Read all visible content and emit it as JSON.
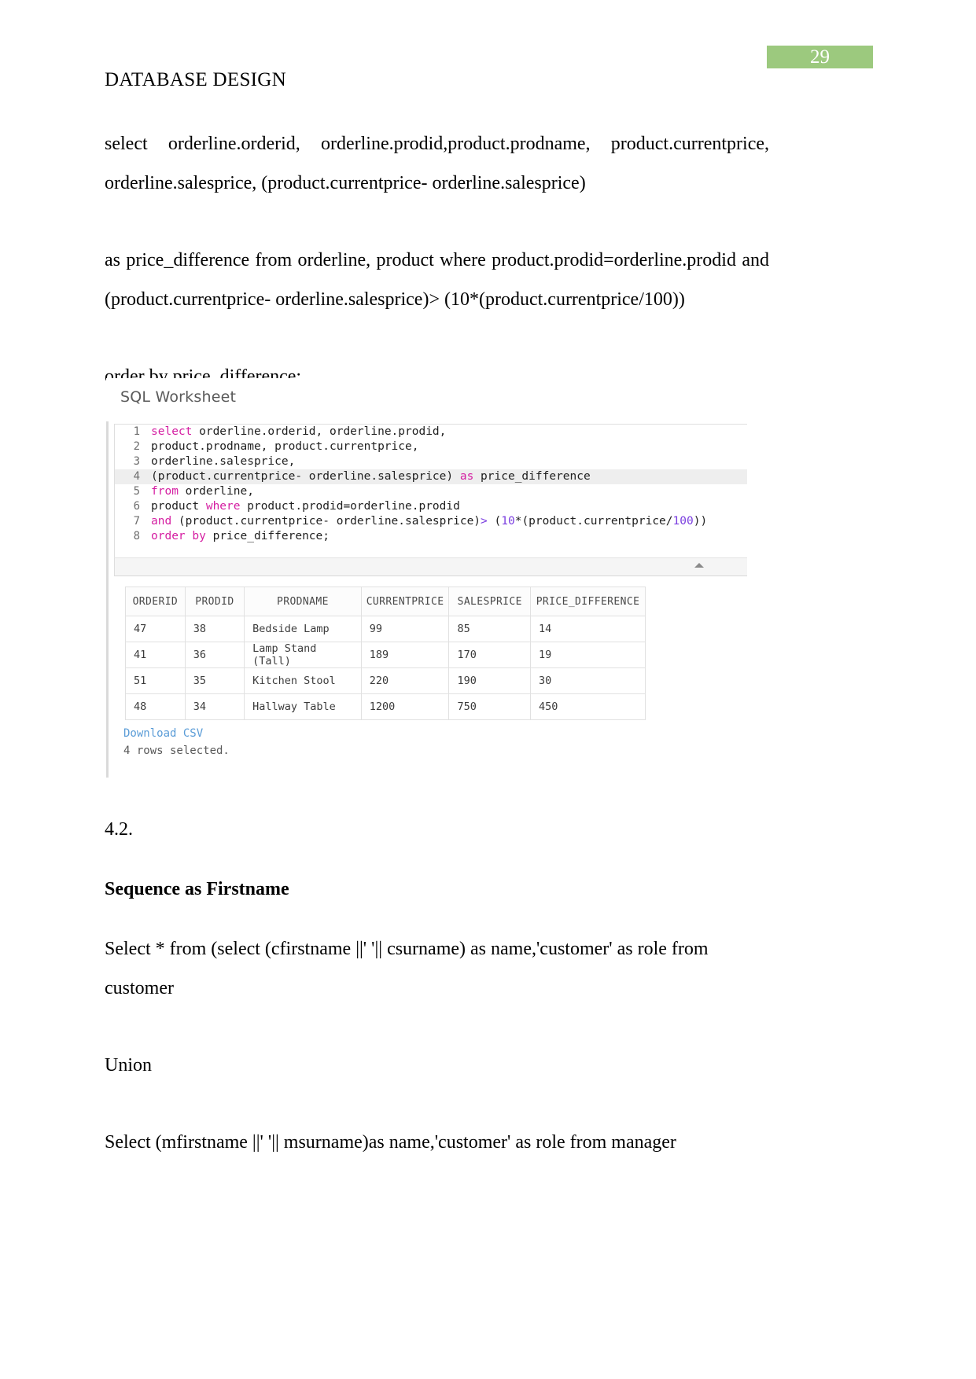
{
  "page": {
    "number": "29",
    "badge_color": "#9cc97e"
  },
  "document": {
    "title": "DATABASE DESIGN",
    "paragraphs": [
      "select     orderline.orderid,      orderline.prodid,product.prodname,      product.currentprice, orderline.salesprice,  (product.currentprice- orderline.salesprice)",
      "as  price_difference  from  orderline,  product  where  product.prodid=orderline.prodid  and (product.currentprice- orderline.salesprice)> (10*(product.currentprice/100))",
      "order by price_difference;"
    ],
    "section_number": "4.2.",
    "section_heading": "Sequence as Firstname",
    "closing_paragraphs": [
      "Select * from (select  (cfirstname ||' '|| csurname) as name,'customer' as role from customer",
      "Union",
      "Select  (mfirstname ||' '|| msurname)as name,'customer' as role  from manager"
    ]
  },
  "screenshot": {
    "title": "SQL Worksheet",
    "highlighted_line": 4,
    "code_lines": [
      {
        "n": "1",
        "segments": [
          {
            "t": "select",
            "c": "kw"
          },
          {
            "t": " orderline.orderid, orderline.prodid,",
            "c": ""
          }
        ]
      },
      {
        "n": "2",
        "segments": [
          {
            "t": "product.prodname, product.currentprice,",
            "c": ""
          }
        ]
      },
      {
        "n": "3",
        "segments": [
          {
            "t": "orderline.salesprice,",
            "c": ""
          }
        ]
      },
      {
        "n": "4",
        "segments": [
          {
            "t": "(product.currentprice- orderline.salesprice) ",
            "c": ""
          },
          {
            "t": "as",
            "c": "kw"
          },
          {
            "t": " price_difference",
            "c": ""
          }
        ]
      },
      {
        "n": "5",
        "segments": [
          {
            "t": "from",
            "c": "kw"
          },
          {
            "t": " orderline,",
            "c": ""
          }
        ]
      },
      {
        "n": "6",
        "segments": [
          {
            "t": "product ",
            "c": ""
          },
          {
            "t": "where",
            "c": "kw"
          },
          {
            "t": " product.prodid=orderline.prodid",
            "c": ""
          }
        ]
      },
      {
        "n": "7",
        "segments": [
          {
            "t": "and",
            "c": "kw"
          },
          {
            "t": " (product.currentprice- orderline.salesprice)",
            "c": ""
          },
          {
            "t": ">",
            "c": "op"
          },
          {
            "t": " (",
            "c": ""
          },
          {
            "t": "10",
            "c": "num"
          },
          {
            "t": "*(product.currentprice/",
            "c": ""
          },
          {
            "t": "100",
            "c": "num"
          },
          {
            "t": "))",
            "c": ""
          }
        ]
      },
      {
        "n": "8",
        "segments": [
          {
            "t": "order",
            "c": "kw"
          },
          {
            "t": " ",
            "c": ""
          },
          {
            "t": "by",
            "c": "kw"
          },
          {
            "t": " price_difference;",
            "c": ""
          }
        ]
      }
    ],
    "results": {
      "columns": [
        "ORDERID",
        "PRODID",
        "PRODNAME",
        "CURRENTPRICE",
        "SALESPRICE",
        "PRICE_DIFFERENCE"
      ],
      "rows": [
        [
          "47",
          "38",
          "Bedside Lamp",
          "99",
          "85",
          "14"
        ],
        [
          "41",
          "36",
          "Lamp Stand (Tall)",
          "189",
          "170",
          "19"
        ],
        [
          "51",
          "35",
          "Kitchen Stool",
          "220",
          "190",
          "30"
        ],
        [
          "48",
          "34",
          "Hallway Table",
          "1200",
          "750",
          "450"
        ]
      ]
    },
    "download_link": "Download CSV",
    "rows_note": "4 rows selected."
  }
}
